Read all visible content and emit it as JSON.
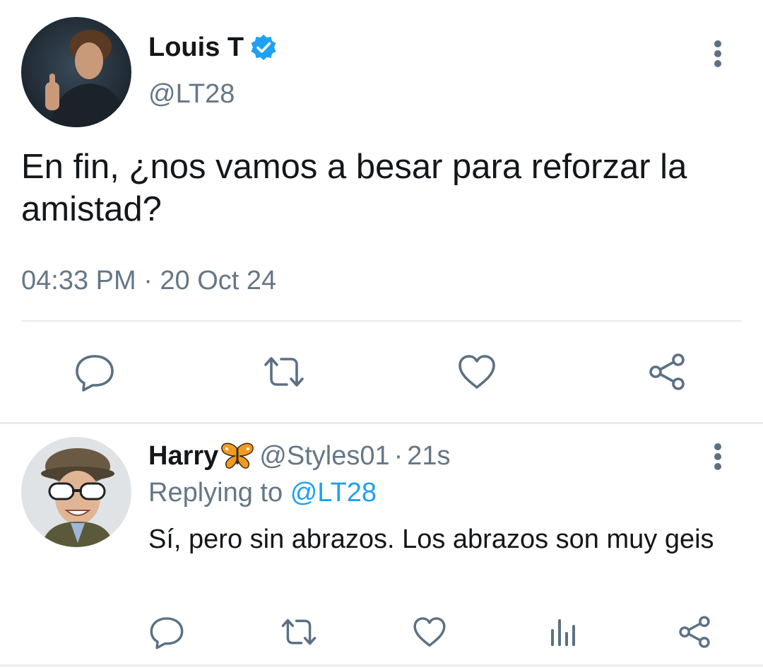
{
  "tweet": {
    "display_name": "Louis T",
    "handle": "@LT28",
    "text": "En fin, ¿nos vamos a besar para reforzar la amistad?",
    "timestamp": "04:33 PM · 20 Oct 24",
    "verified": true,
    "actions": [
      "reply-icon",
      "retweet-icon",
      "like-icon",
      "share-icon"
    ]
  },
  "reply": {
    "display_name": "Harry",
    "emoji": "butterfly",
    "handle": "@Styles01",
    "separator": "·",
    "time": "21s",
    "replying_prefix": "Replying to",
    "replying_to": "@LT28",
    "text": "Sí, pero sin abrazos. Los abrazos son muy geis",
    "actions": [
      "reply-icon",
      "retweet-icon",
      "like-icon",
      "analytics-icon",
      "share-icon"
    ]
  },
  "colors": {
    "text_primary": "#14171a",
    "text_secondary": "#657786",
    "accent": "#1da1f2",
    "icon": "#5b7083",
    "divider": "#e6ecf0"
  }
}
